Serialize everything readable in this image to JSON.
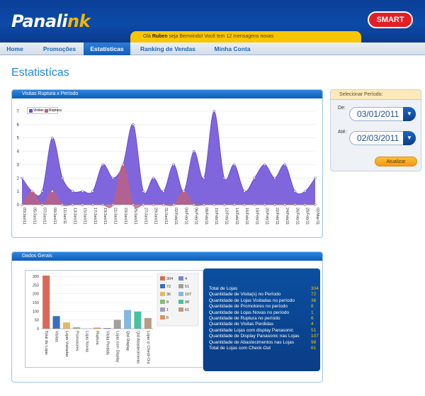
{
  "header": {
    "logo_main": "Panali",
    "logo_accent": "nk",
    "brand_badge": "SMART",
    "welcome_prefix": "Olá",
    "user": "Ruben",
    "welcome_suffix": "seja Bemvindo!  Você tem 12 mensagens novas"
  },
  "nav": {
    "tabs": [
      {
        "label": "Home"
      },
      {
        "label": "Promoções"
      },
      {
        "label": "Estatísticas"
      },
      {
        "label": "Ranking de Vendas"
      },
      {
        "label": "Minha Conta"
      }
    ]
  },
  "page": {
    "title": "Estatistícas"
  },
  "visits_panel": {
    "title": "Visitas Ruptura x Período",
    "legend": [
      "Visitas",
      "Ruptura"
    ]
  },
  "period_panel": {
    "title": "Selecionar Período:",
    "from_label": "De:",
    "from_value": "03/01/2011",
    "to_label": "Até:",
    "to_value": "02/03/2011",
    "button_label": "Atualizar"
  },
  "dados_panel": {
    "title": "Dados Gerais",
    "stats": [
      {
        "label": "Total de Lojas",
        "value": "304"
      },
      {
        "label": "Quantidade de Visita(s) no Período",
        "value": "72"
      },
      {
        "label": "Quantidade de Lojas Visitadas no período",
        "value": "36"
      },
      {
        "label": "Quantidade de Promotores no período",
        "value": "8"
      },
      {
        "label": "Quantidade de Lojas Novas no período",
        "value": "1"
      },
      {
        "label": "Quantidade de Ruptura no período",
        "value": "6"
      },
      {
        "label": "Quantidade de Visitas Perdidas",
        "value": "4"
      },
      {
        "label": "Quantidade Lojas com display Panasonic",
        "value": "51"
      },
      {
        "label": "Quantidade de Display Panasonic nas Lojas",
        "value": "107"
      },
      {
        "label": "Quantidade de Abastecimentos nas Lojas",
        "value": "98"
      },
      {
        "label": "Total de Lojas com Check-Out",
        "value": "61"
      }
    ]
  },
  "chart_data": [
    {
      "type": "area",
      "title": "Visitas Ruptura x Período",
      "ylim": [
        0,
        7
      ],
      "yticks": [
        0,
        1,
        2,
        3,
        4,
        5,
        6,
        7
      ],
      "x": [
        "03/Jan/11",
        "05/Jan/11",
        "07/Jan/11",
        "09/Jan/11",
        "11/Jan/11",
        "13/Jan/11",
        "15/Jan/11",
        "17/Jan/11",
        "19/Jan/11",
        "21/Jan/11",
        "23/Jan/11",
        "25/Jan/11",
        "27/Jan/11",
        "29/Jan/11",
        "31/Jan/11",
        "02/Feb/11",
        "04/Feb/11",
        "06/Feb/11",
        "08/Feb/11",
        "10/Feb/11",
        "12/Feb/11",
        "14/Feb/11",
        "16/Feb/11",
        "18/Feb/11",
        "20/Feb/11",
        "22/Feb/11",
        "24/Feb/11",
        "26/Feb/11",
        "28/Feb/11",
        "02/Mar/11"
      ],
      "series": [
        {
          "name": "Visitas",
          "color": "#6a4bd6",
          "values": [
            2,
            1,
            1,
            5,
            2,
            1,
            1,
            1,
            3,
            2,
            3,
            6,
            1,
            2,
            1,
            3,
            1,
            4,
            2,
            7,
            2,
            3,
            1,
            2,
            3,
            2,
            3,
            1,
            1,
            2
          ]
        },
        {
          "name": "Ruptura",
          "color": "#c2607a",
          "values": [
            0,
            1,
            0,
            1,
            0,
            0,
            0,
            0,
            0,
            0,
            3,
            0,
            0,
            0,
            0,
            0,
            1,
            0,
            0,
            0,
            0,
            0,
            0,
            0,
            0,
            0,
            0,
            0,
            0,
            0
          ]
        }
      ],
      "legend_position": "top-left",
      "grid": true
    },
    {
      "type": "bar",
      "categories": [
        "Total de Lojas",
        "Visitas",
        "Lojas Visitadas",
        "Promotores",
        "Lojas Novas",
        "Ruptura",
        "Visita Perdida",
        "Lojas com Display",
        "Qtd Display",
        "Qtd Abastecimento",
        "Lojas c/ Check-Out"
      ],
      "values": [
        304,
        72,
        36,
        8,
        1,
        6,
        4,
        51,
        107,
        98,
        61
      ],
      "colors": [
        "#d96a5a",
        "#3a6fc0",
        "#e2b96a",
        "#84bc7a",
        "#9aa0b8",
        "#e3905a",
        "#7b83d0",
        "#a0a0a0",
        "#85b8e0",
        "#46c39a",
        "#b89b86"
      ],
      "ylim": [
        0,
        300
      ],
      "yticks": [
        0,
        50,
        100,
        150,
        200,
        250,
        300
      ],
      "legend": [
        "304",
        "72",
        "36",
        "8",
        "1",
        "6",
        "4",
        "51",
        "107",
        "98",
        "61"
      ],
      "legend_position": "top-right",
      "grid": true
    }
  ]
}
